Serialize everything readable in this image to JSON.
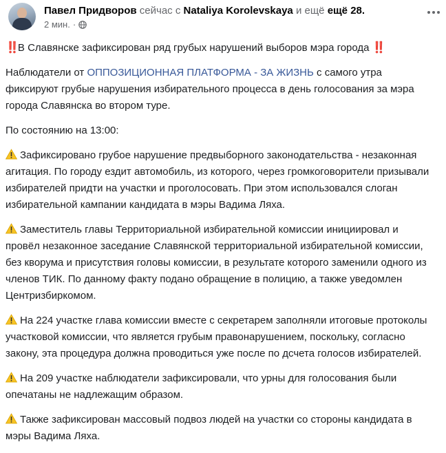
{
  "post": {
    "author": "Павел Придворов",
    "with_text": "сейчас с",
    "tagged_person": "Nataliya Korolevskaya",
    "and_text": "и ещё",
    "others_count": "ещё 28.",
    "time": "2 мин.",
    "separator": "·",
    "privacy_icon": "globe-icon",
    "menu_icon": "more-horizontal-icon",
    "headline_emoji": "‼️",
    "headline": "В Славянске зафиксирован ряд грубых нарушений выборов мэра города",
    "intro_prefix": "Наблюдатели от",
    "intro_link": "ОППОЗИЦИОННАЯ ПЛАТФОРМА - ЗА ЖИЗНЬ",
    "intro_suffix": "с самого утра фиксируют грубые нарушения избирательного процесса в день голосования за мэра города Славянска во втором туре.",
    "status_time": "По состоянию на 13:00:",
    "items": [
      "Зафиксировано грубое нарушение предвыборного законодательства - незаконная агитация. По городу ездит автомобиль, из которого, через громкоговорители призывали избирателей придти на участки и проголосовать. При этом использовался слоган избирательной кампании кандидата в мэры Вадима Ляха.",
      "Заместитель главы Территориальной избирательной комиссии инициировал и провёл незаконное заседание Славянской территориальной избирательной комиссии, без кворума и присутствия головы комиссии, в результате которого заменили одного из членов ТИК. По данному факту подано обращение в полицию, а также уведомлен Центризбиркомом.",
      "На 224 участке глава комиссии вместе с секретарем заполняли итоговые протоколы участковой комиссии, что является грубым правонарушением, поскольку, согласно закону, эта процедура должна проводиться уже после по дсчета голосов избирателей.",
      "На 209 участке наблюдатели зафиксировали, что урны для голосования были опечатаны не надлежащим образом.",
      "Также зафиксирован массовый подвоз людей на участки со стороны кандидата в мэры Вадима Ляха."
    ],
    "colors": {
      "link": "#385898",
      "text": "#1c1e21",
      "muted": "#65676b",
      "warning": "#f7c325",
      "alert": "#e02424"
    }
  }
}
